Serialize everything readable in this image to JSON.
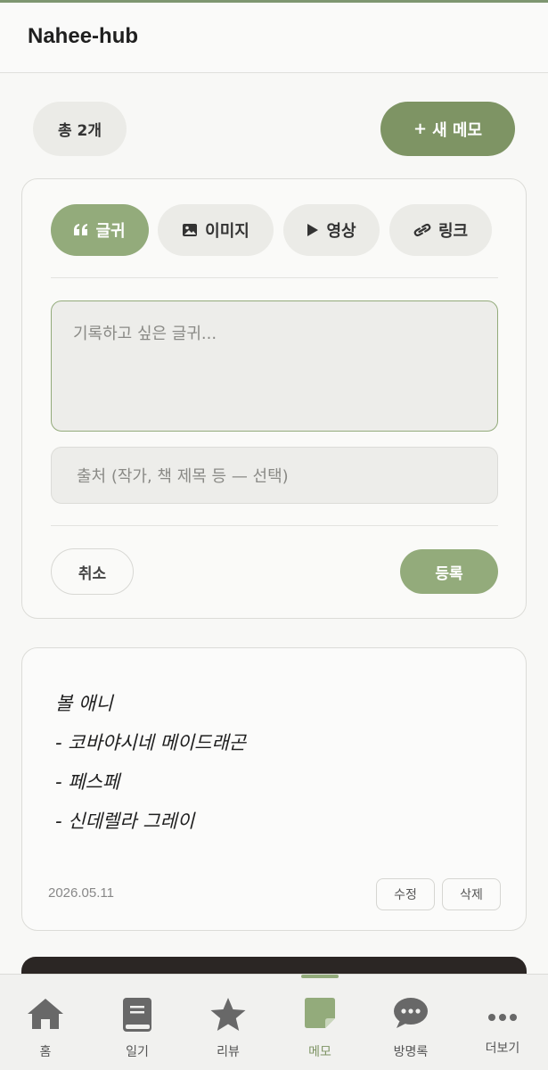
{
  "header": {
    "brand": "Nahee-hub"
  },
  "toolbar": {
    "count_label": "총 2개",
    "new_memo_label": "새 메모",
    "new_memo_plus": "+"
  },
  "composer": {
    "tabs": [
      {
        "label": "글귀",
        "icon": "quote-icon",
        "active": true
      },
      {
        "label": "이미지",
        "icon": "image-icon",
        "active": false
      },
      {
        "label": "영상",
        "icon": "play-icon",
        "active": false
      },
      {
        "label": "링크",
        "icon": "link-icon",
        "active": false
      }
    ],
    "text_placeholder": "기록하고 싶은 글귀...",
    "source_placeholder": "출처 (작가, 책 제목 등 — 선택)",
    "cancel_label": "취소",
    "submit_label": "등록"
  },
  "memos": [
    {
      "lines": [
        "볼 애니",
        "- 코바야시네 메이드래곤",
        "- 페스페",
        "- 신데렐라 그레이"
      ],
      "date": "2026.05.11",
      "edit_label": "수정",
      "delete_label": "삭제"
    }
  ],
  "nav": {
    "items": [
      {
        "label": "홈",
        "icon": "home-icon"
      },
      {
        "label": "일기",
        "icon": "book-icon"
      },
      {
        "label": "리뷰",
        "icon": "star-icon"
      },
      {
        "label": "메모",
        "icon": "note-icon",
        "active": true
      },
      {
        "label": "방명록",
        "icon": "chat-icon"
      },
      {
        "label": "더보기",
        "icon": "more-icon"
      }
    ]
  },
  "colors": {
    "accent": "#93ab7b",
    "accent_dark": "#7e9464",
    "background": "#f8f8f6"
  }
}
